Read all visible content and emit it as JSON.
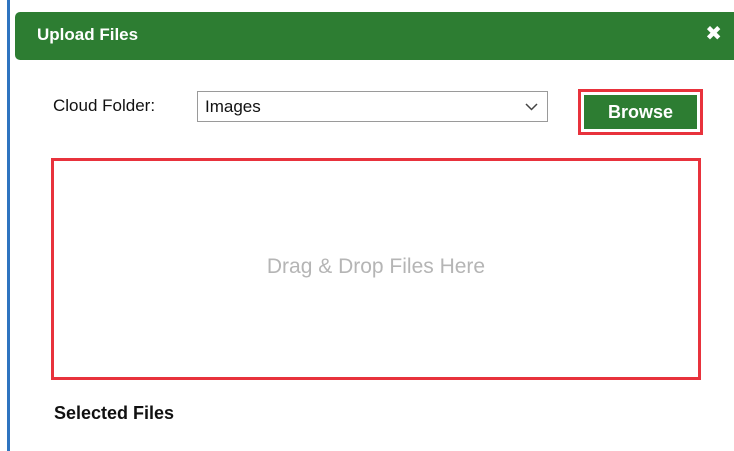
{
  "dialog": {
    "title": "Upload Files",
    "close_symbol": "✖",
    "close_icon": "close-icon"
  },
  "form": {
    "folder_label": "Cloud Folder:",
    "folder_value": "Images",
    "dropdown_icon": "chevron-down-icon",
    "browse_label": "Browse"
  },
  "dropzone": {
    "text": "Drag & Drop Files Here"
  },
  "selected": {
    "heading": "Selected Files"
  },
  "colors": {
    "header_green": "#2d7d32",
    "highlight_red": "#e8323c",
    "placeholder_gray": "#b5b5b5"
  }
}
